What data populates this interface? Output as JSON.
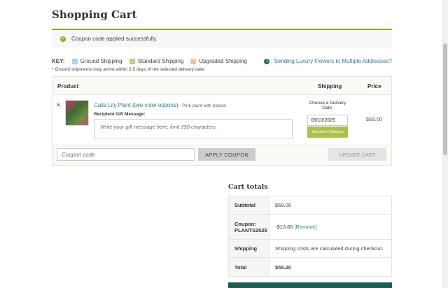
{
  "page": {
    "title": "Shopping Cart"
  },
  "notice": {
    "message": "Coupon code applied successfully."
  },
  "key": {
    "label": "KEY:",
    "items": [
      {
        "label": "Ground Shipping",
        "color": "#a9d3f2"
      },
      {
        "label": "Standard Shipping",
        "color": "#b5d47a"
      },
      {
        "label": "Upgraded Shipping",
        "color": "#f2c88f"
      }
    ],
    "note": "* Ground shipments may arrive within 2-5 days of the selected delivery date."
  },
  "multi_link": {
    "label": "Sending Luxury Flowers to Multiple Addresses?"
  },
  "cart": {
    "headers": {
      "product": "Product",
      "shipping": "Shipping",
      "price": "Price"
    },
    "item": {
      "remove": "×",
      "name": "Calla Lily Plant (two color options)",
      "meta": " - Pink plant with basket",
      "gift_label": "Recipient Gift Message:",
      "gift_placeholder": "Write your gift message here, limit 250 characters.",
      "choose_date": "Choose a Delivery Date:",
      "date": "09/10/2025",
      "shipping_badge": "Standard Shipping",
      "price": "$69.00"
    }
  },
  "coupon": {
    "placeholder": "Coupon code",
    "apply_label": "APPLY COUPON",
    "update_label": "UPDATE CART"
  },
  "totals": {
    "title": "Cart totals",
    "subtotal_label": "Subtotal",
    "subtotal_value": "$69.00",
    "coupon_label": "Coupon: PLANTS2025",
    "coupon_value": "-$13.80",
    "coupon_remove": "[Remove]",
    "shipping_label": "Shipping",
    "shipping_value": "Shipping costs are calculated during checkout.",
    "total_label": "Total",
    "total_value": "$55.20"
  }
}
